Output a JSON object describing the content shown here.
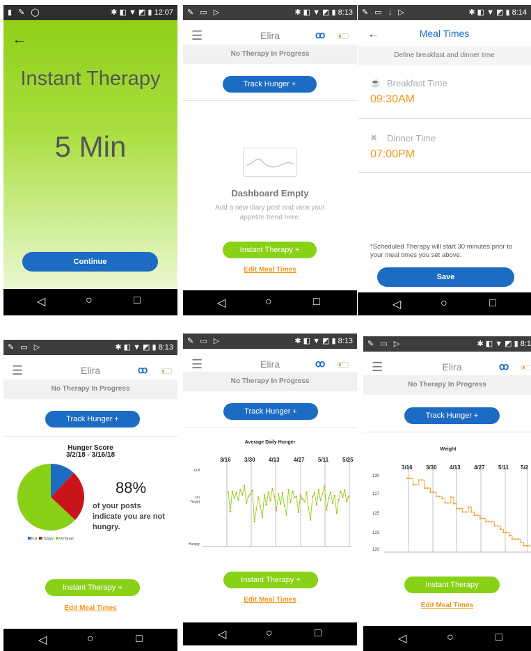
{
  "status": {
    "p1_time": "12:07",
    "p2_time": "8:13",
    "p3_time": "8:14",
    "p4_time": "8:13",
    "p5_time": "8:13",
    "p6_time": "8:1"
  },
  "header": {
    "title": "Elira",
    "no_therapy": "No Therapy In Progress",
    "track_hunger": "Track Hunger +",
    "instant_therapy_plus": "Instant Therapy +",
    "instant_therapy": "Instant Therapy",
    "edit_meal_times": "Edit Meal Times"
  },
  "screen1": {
    "title": "Instant Therapy",
    "duration": "5 Min",
    "continue": "Continue"
  },
  "screen2": {
    "empty_title": "Dashboard Empty",
    "empty_desc": "Add a new diary post and view your appetite trend here."
  },
  "screen3": {
    "title": "Meal Times",
    "subtitle": "Define breakfast and dinner time",
    "breakfast_label": "Breakfast Time",
    "breakfast_value": "09:30AM",
    "dinner_label": "Dinner Time",
    "dinner_value": "07:00PM",
    "note": "*Scheduled Therapy will start 30 minutes prior to your meal times you set above.",
    "save": "Save"
  },
  "screen4": {
    "card_title": "Hunger Score",
    "date_range": "3/2/18 - 3/16/18",
    "percent": "88%",
    "caption": "of your posts indicate you are not hungry."
  },
  "colors": {
    "blue": "#1c6cc4",
    "green": "#88d116",
    "red": "#c8151b",
    "orange": "#f0961e"
  },
  "chart_data": [
    {
      "type": "pie",
      "title": "Hunger Score",
      "subtitle": "3/2/18 - 3/16/18",
      "categories": [
        "Full",
        "Hungry",
        "OnTarget"
      ],
      "values": [
        12,
        25,
        63
      ],
      "legend": "bottom-left"
    },
    {
      "type": "line",
      "title": "Average Daily Hunger",
      "xlabel": "",
      "ylabel": "",
      "x_ticks": [
        "3/16",
        "3/30",
        "4/13",
        "4/27",
        "5/11",
        "5/25"
      ],
      "y_ticks": [
        "Full",
        "On Target",
        "Hungry"
      ],
      "ylim": [
        0,
        10
      ],
      "series": [
        {
          "values": [
            6.5,
            4.2,
            6.6,
            5.8,
            6.4,
            5.6,
            6.8,
            6.2,
            7.3,
            5.2,
            6.0,
            6.3,
            6.7,
            3.0,
            4.5,
            5.9,
            4.8,
            3.5,
            6.2,
            5.0,
            6.5,
            5.5,
            6.9,
            6.0,
            4.3,
            6.3,
            5.1,
            6.4,
            4.9,
            3.8,
            6.8,
            5.3,
            6.6,
            5.9,
            6.0,
            4.1,
            6.2,
            5.7,
            5.4,
            6.5,
            4.6,
            3.2,
            6.0,
            6.4,
            5.0,
            6.8,
            5.5,
            6.3,
            7.2,
            4.4,
            5.8,
            6.5,
            5.2,
            6.1,
            4.0,
            5.6,
            6.6,
            5.9,
            6.8,
            5.4,
            6.0
          ]
        }
      ],
      "grid": true
    },
    {
      "type": "line",
      "title": "Weight",
      "x_ticks": [
        "3/16",
        "3/30",
        "4/13",
        "4/27",
        "5/11",
        "5/2"
      ],
      "y_ticks": [
        "130",
        "127",
        "125",
        "123",
        "120"
      ],
      "ylim": [
        120,
        130
      ],
      "series": [
        {
          "values": [
            129.5,
            129.5,
            128.7,
            128.7,
            129.3,
            129.3,
            128.3,
            128.3,
            127.8,
            127.8,
            127.3,
            127.3,
            127.0,
            126.5,
            126.5,
            127.2,
            126.4,
            125.8,
            125.8,
            125.4,
            125.4,
            126.0,
            125.4,
            125.0,
            125.0,
            124.6,
            124.6,
            124.2,
            124.2,
            124.2,
            123.7,
            123.7,
            123.3,
            122.9,
            122.9,
            122.5,
            122.1,
            122.1,
            122.1,
            121.7,
            121.3,
            121.3,
            121.3
          ]
        }
      ],
      "grid": true
    }
  ]
}
